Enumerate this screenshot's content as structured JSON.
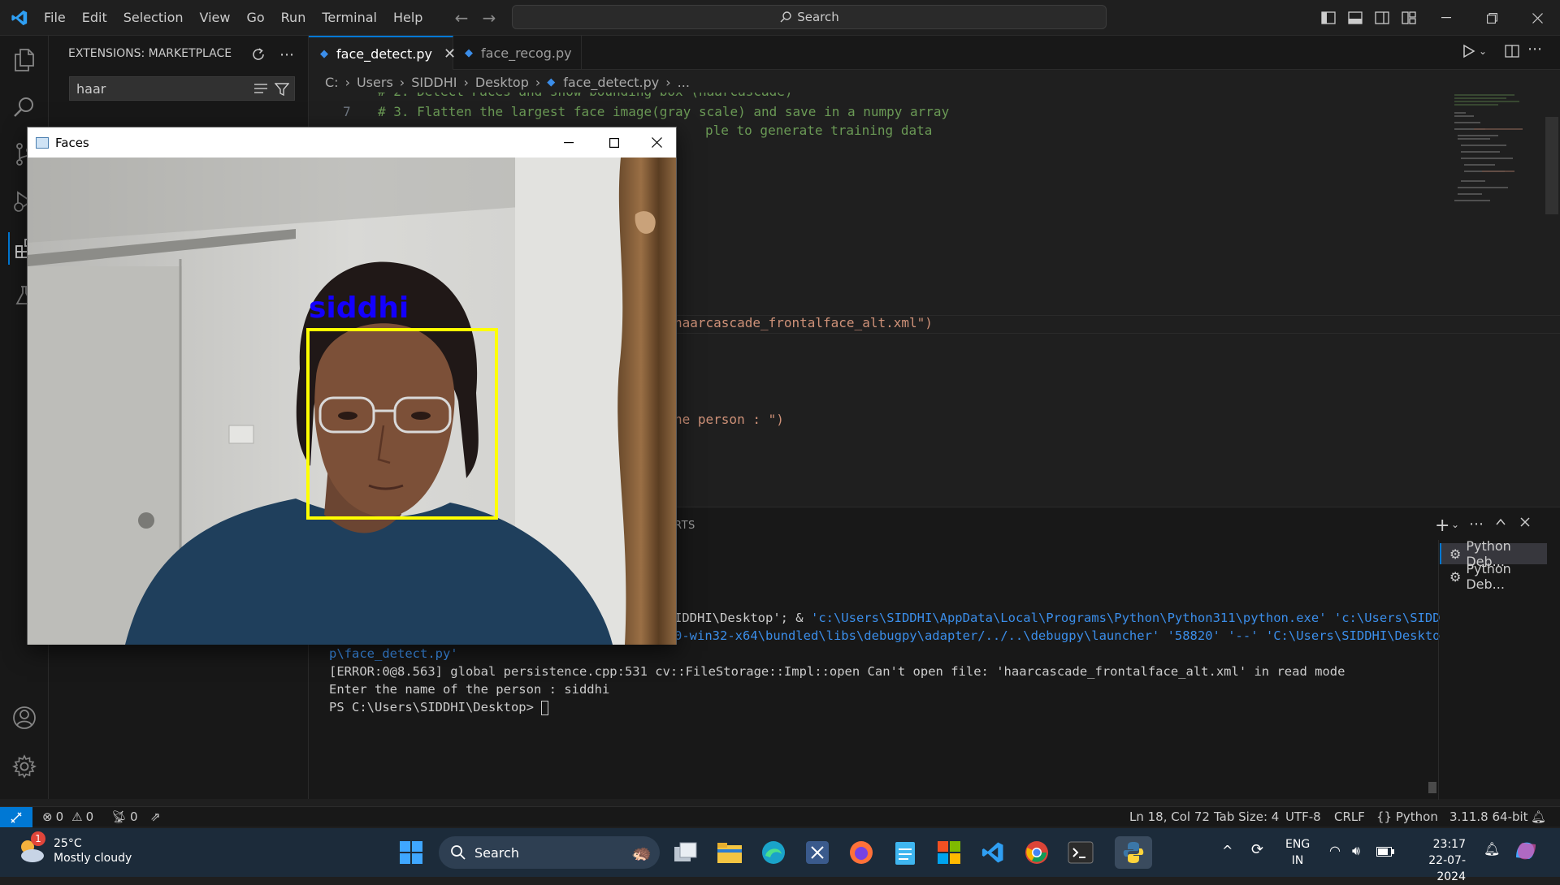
{
  "titlebar": {
    "menu": [
      "File",
      "Edit",
      "Selection",
      "View",
      "Go",
      "Run",
      "Terminal",
      "Help"
    ],
    "search_placeholder": "Search"
  },
  "sidebar": {
    "title": "EXTENSIONS: MARKETPLACE",
    "search_value": "haar"
  },
  "tabs": [
    {
      "label": "face_detect.py",
      "active": true
    },
    {
      "label": "face_recog.py",
      "active": false
    }
  ],
  "breadcrumb": [
    "C:",
    "Users",
    "SIDDHI",
    "Desktop",
    "face_detect.py",
    "..."
  ],
  "editor": {
    "line6_partial": "# 2. Detect Faces and show bounding box (haarcascade)",
    "line7_num": "7",
    "line7": "# 3. Flatten the largest face image(gray scale) and save in a numpy array",
    "line8_partial": "ple to generate training data",
    "line18_partial": "haarcascade_frontalface_alt.xml\")",
    "line_input_partial": "he person : \")"
  },
  "panel": {
    "tab_partial": "RTS",
    "terminal_lines": [
      {
        "prefix": "IDDHI\\Desktop'; & ",
        "link": "'c:\\Users\\SIDDHI\\AppData\\Local\\Programs\\Python\\Python311\\python.exe' 'c:\\Users\\SIDD"
      },
      {
        "prefix": "",
        "link": "0-win32-x64\\bundled\\libs\\debugpy\\adapter/../..\\debugpy\\launcher' '58820' '--' 'C:\\Users\\SIDDHI\\Deskto"
      },
      {
        "prefix": "",
        "link": "p\\face_detect.py'"
      }
    ],
    "error_line": "[ERROR:0@8.563] global persistence.cpp:531 cv::FileStorage::Impl::open Can't open file: 'haarcascade_frontalface_alt.xml' in read mode",
    "prompt_line": "Enter the name of the person : siddhi",
    "ps_line": "PS C:\\Users\\SIDDHI\\Desktop> ",
    "side_terminals": [
      "Python Deb...",
      "Python Deb..."
    ]
  },
  "statusbar": {
    "errors": "0",
    "warnings": "0",
    "ports": "0",
    "position": "Ln 18, Col 72",
    "tab_size": "Tab Size: 4",
    "encoding": "UTF-8",
    "eol": "CRLF",
    "language": "Python",
    "interpreter": "3.11.8 64-bit"
  },
  "faces_window": {
    "title": "Faces",
    "face_label": "siddhi",
    "label_color": "#1400ff",
    "box_color": "#ffff00"
  },
  "taskbar": {
    "weather_temp": "25°C",
    "weather_desc": "Mostly cloudy",
    "weather_badge": "1",
    "search_label": "Search",
    "lang": "ENG",
    "region": "IN",
    "time": "23:17",
    "date": "22-07-2024"
  }
}
